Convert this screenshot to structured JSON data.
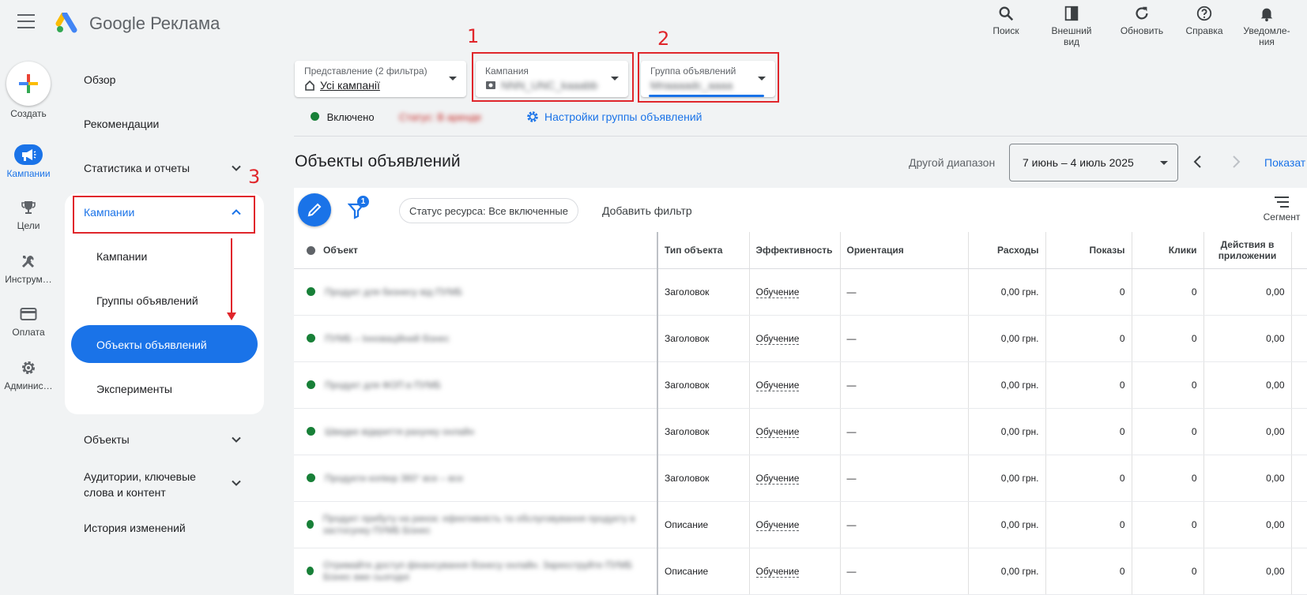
{
  "app": {
    "brand_google": "Google",
    "brand_product": "Реклама"
  },
  "top_actions": [
    {
      "label": "Поиск",
      "icon": "search-icon"
    },
    {
      "label": "Внешний вид",
      "icon": "appearance-icon"
    },
    {
      "label": "Обновить",
      "icon": "refresh-icon"
    },
    {
      "label": "Справка",
      "icon": "help-icon"
    },
    {
      "label": "Уведомле-ния",
      "icon": "bell-icon"
    }
  ],
  "rail": {
    "create": "Создать",
    "items": [
      {
        "label": "Кампании",
        "icon": "megaphone-icon",
        "active": true
      },
      {
        "label": "Цели",
        "icon": "trophy-icon"
      },
      {
        "label": "Инструм…",
        "icon": "tools-icon"
      },
      {
        "label": "Оплата",
        "icon": "credit-card-icon"
      },
      {
        "label": "Админис…",
        "icon": "gear-icon"
      }
    ]
  },
  "nav": {
    "overview": "Обзор",
    "recommendations": "Рекомендации",
    "stats": "Статистика и отчеты",
    "campaigns": "Кампании",
    "sub": {
      "campaigns": "Кампании",
      "adgroups": "Группы объявлений",
      "assets": "Объекты объявлений",
      "experiments": "Эксперименты"
    },
    "objects": "Объекты",
    "audiences": "Аудитории, ключевые слова и контент",
    "history": "История изменений"
  },
  "filters": {
    "view_caption": "Представление (2 фильтра)",
    "view_value": "Усі кампанії",
    "campaign_caption": "Кампания",
    "campaign_value": "NNN_UNC_kaaabb",
    "adgroup_caption": "Группа объявлений",
    "adgroup_value": "Мпааааdc_аааа"
  },
  "annotations": {
    "n1": "1",
    "n2": "2",
    "n3": "3"
  },
  "status": {
    "enabled": "Включено",
    "blurred": "Статус: В аренде",
    "settings_link": "Настройки группы объявлений"
  },
  "page": {
    "title": "Объекты объявлений",
    "date_label": "Другой диапазон",
    "date_value": "7 июнь – 4 июль 2025",
    "show_link": "Показат"
  },
  "toolbar": {
    "filter_badge": "1",
    "status_chip": "Статус ресурса: Все включенные",
    "add_filter": "Добавить фильтр",
    "segment": "Сегмент"
  },
  "table": {
    "headers": {
      "object": "Объект",
      "type": "Тип объекта",
      "performance": "Эффективность",
      "orientation": "Ориентация",
      "cost": "Расходы",
      "impressions": "Показы",
      "clicks": "Клики",
      "app_actions": "Действия в приложении"
    },
    "rows": [
      {
        "object": "Продукт для бизнесу від ПУМБ",
        "type": "Заголовок",
        "performance": "Обучение",
        "orientation": "—",
        "cost": "0,00 грн.",
        "impressions": "0",
        "clicks": "0",
        "app_actions": "0,00"
      },
      {
        "object": "ПУМБ – Інноваційний бізнес",
        "type": "Заголовок",
        "performance": "Обучение",
        "orientation": "—",
        "cost": "0,00 грн.",
        "impressions": "0",
        "clicks": "0",
        "app_actions": "0,00"
      },
      {
        "object": "Продукт для ФОП в ПУМБ",
        "type": "Заголовок",
        "performance": "Обучение",
        "orientation": "—",
        "cost": "0,00 грн.",
        "impressions": "0",
        "clicks": "0",
        "app_actions": "0,00"
      },
      {
        "object": "Швидке відкриття рахунку онлайн",
        "type": "Заголовок",
        "performance": "Обучение",
        "orientation": "—",
        "cost": "0,00 грн.",
        "impressions": "0",
        "clicks": "0",
        "app_actions": "0,00"
      },
      {
        "object": "Продукти копіюр 360° все – все",
        "type": "Заголовок",
        "performance": "Обучение",
        "orientation": "—",
        "cost": "0,00 грн.",
        "impressions": "0",
        "clicks": "0",
        "app_actions": "0,00"
      },
      {
        "object": "Продукт прибуту на ринок: ефективність та обслуговування продукту в застосунку ПУМБ Бізнес",
        "type": "Описание",
        "performance": "Обучение",
        "orientation": "—",
        "cost": "0,00 грн.",
        "impressions": "0",
        "clicks": "0",
        "app_actions": "0,00"
      },
      {
        "object": "Отримайте доступ фінансування бізнесу онлайн. Зареєструйте ПУМБ Бізнес вже сьогодні",
        "type": "Описание",
        "performance": "Обучение",
        "orientation": "—",
        "cost": "0,00 грн.",
        "impressions": "0",
        "clicks": "0",
        "app_actions": "0,00"
      }
    ]
  },
  "colors": {
    "accent": "#1a73e8",
    "annotation_red": "#e0262b",
    "status_green": "#188038"
  }
}
